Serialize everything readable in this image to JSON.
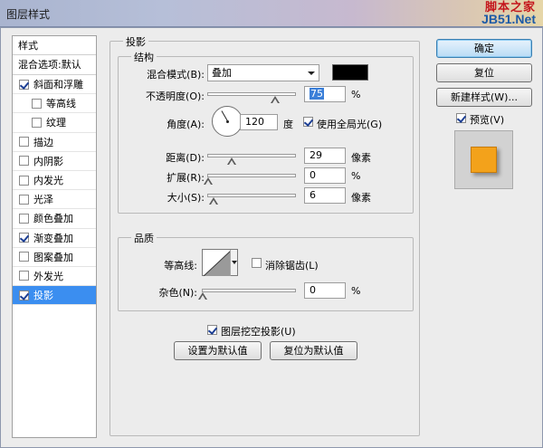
{
  "window": {
    "title": "图层样式",
    "watermark_line1": "脚本之家",
    "watermark_line2": "JB51.Net"
  },
  "sidebar": {
    "header": "样式",
    "blend_options": "混合选项:默认",
    "items": [
      {
        "label": "斜面和浮雕",
        "checked": true,
        "sub": false
      },
      {
        "label": "等高线",
        "checked": false,
        "sub": true
      },
      {
        "label": "纹理",
        "checked": false,
        "sub": true
      },
      {
        "label": "描边",
        "checked": false,
        "sub": false
      },
      {
        "label": "内阴影",
        "checked": false,
        "sub": false
      },
      {
        "label": "内发光",
        "checked": false,
        "sub": false
      },
      {
        "label": "光泽",
        "checked": false,
        "sub": false
      },
      {
        "label": "颜色叠加",
        "checked": false,
        "sub": false
      },
      {
        "label": "渐变叠加",
        "checked": true,
        "sub": false
      },
      {
        "label": "图案叠加",
        "checked": false,
        "sub": false
      },
      {
        "label": "外发光",
        "checked": false,
        "sub": false
      },
      {
        "label": "投影",
        "checked": true,
        "sub": false,
        "selected": true
      }
    ]
  },
  "panel": {
    "title": "投影",
    "structure": {
      "title": "结构",
      "blend_mode_label": "混合模式(B):",
      "blend_mode_value": "叠加",
      "shadow_color": "#000000",
      "opacity_label": "不透明度(O):",
      "opacity_value": "75",
      "opacity_unit": "%",
      "angle_label": "角度(A):",
      "angle_value": "120",
      "angle_unit": "度",
      "global_light_label": "使用全局光(G)",
      "global_light_checked": true,
      "distance_label": "距离(D):",
      "distance_value": "29",
      "distance_unit": "像素",
      "spread_label": "扩展(R):",
      "spread_value": "0",
      "spread_unit": "%",
      "size_label": "大小(S):",
      "size_value": "6",
      "size_unit": "像素"
    },
    "quality": {
      "title": "品质",
      "contour_label": "等高线:",
      "antialias_label": "消除锯齿(L)",
      "antialias_checked": false,
      "noise_label": "杂色(N):",
      "noise_value": "0",
      "noise_unit": "%"
    },
    "knockout_label": "图层挖空投影(U)",
    "knockout_checked": true,
    "make_default_label": "设置为默认值",
    "reset_default_label": "复位为默认值"
  },
  "right": {
    "ok_label": "确定",
    "reset_label": "复位",
    "new_style_label": "新建样式(W)...",
    "preview_label": "预览(V)",
    "preview_checked": true,
    "preview_color": "#f3a21b"
  }
}
